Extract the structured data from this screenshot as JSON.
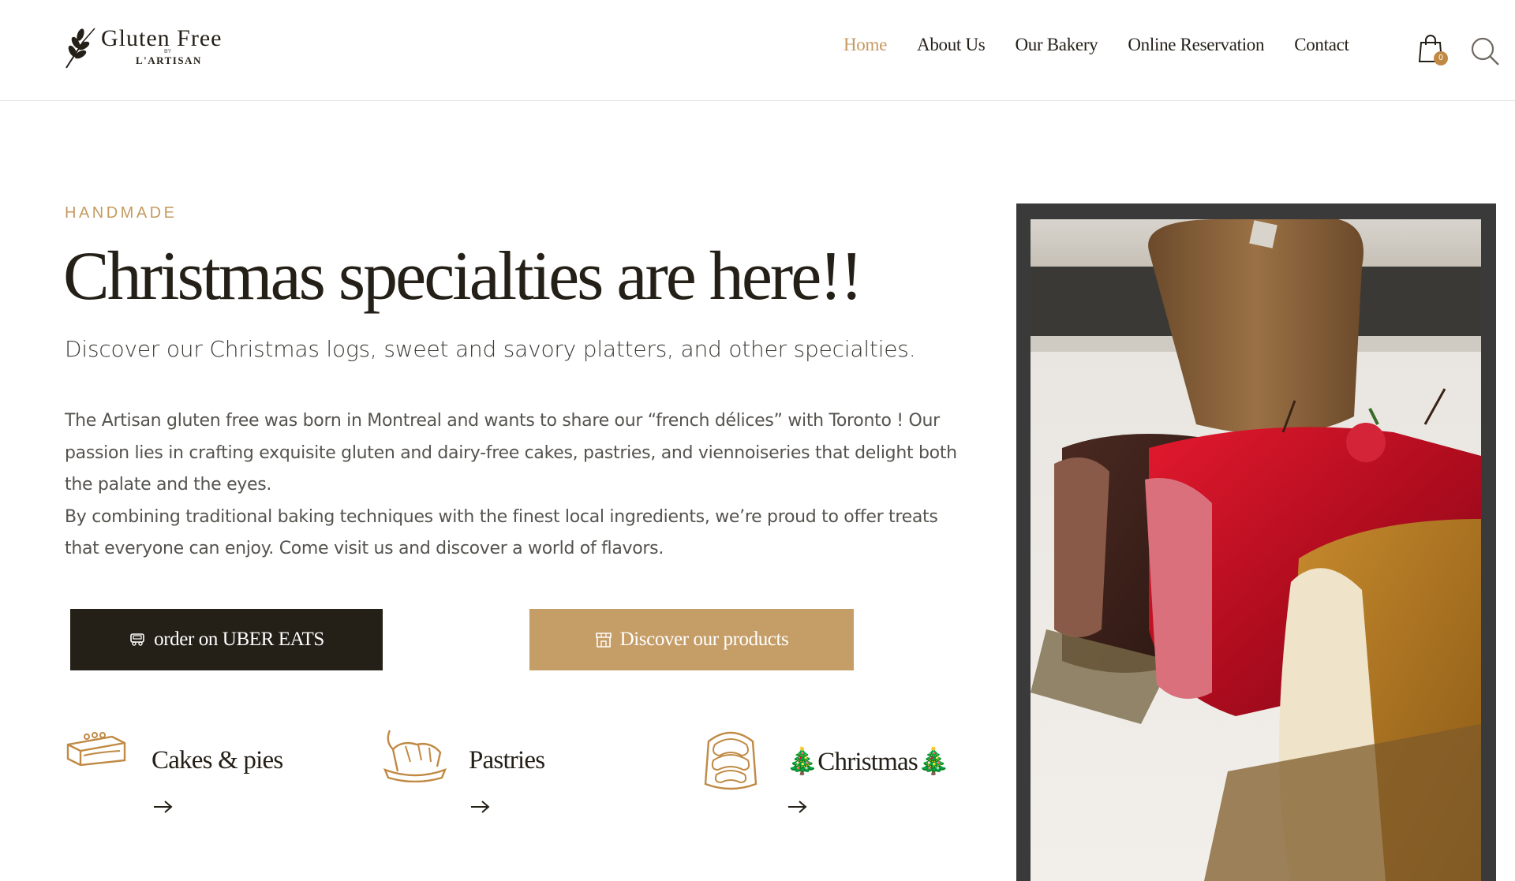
{
  "brand": {
    "title": "Gluten Free",
    "by": "BY",
    "subtitle": "L'ARTISAN"
  },
  "nav": {
    "items": [
      {
        "label": "Home",
        "active": true
      },
      {
        "label": "About Us"
      },
      {
        "label": "Our Bakery"
      },
      {
        "label": "Online Reservation"
      },
      {
        "label": "Contact"
      }
    ]
  },
  "cart": {
    "count": "0",
    "icon": "shopping-bag-icon"
  },
  "search": {
    "icon": "search-icon"
  },
  "hero": {
    "eyebrow": "HANDMADE",
    "headline": "Christmas specialties are here!!",
    "subhead": "Discover our Christmas logs, sweet and savory platters, and other specialties.",
    "paragraph1": "The Artisan gluten free was born in Montreal and wants to share our “french délices” with Toronto ! Our passion lies in crafting exquisite gluten and dairy-free cakes, pastries, and viennoiseries that delight both the palate and the eyes.",
    "paragraph2": "By combining traditional baking techniques with the finest local ingredients, we’re proud to offer treats that everyone can enjoy. Come visit us and discover a world of flavors."
  },
  "buttons": {
    "uber": {
      "label": "order on UBER EATS",
      "icon": "delivery-truck-icon"
    },
    "products": {
      "label": "Discover our products",
      "icon": "storefront-icon"
    }
  },
  "categories": [
    {
      "label": "Cakes & pies",
      "icon": "cake-icon",
      "arrow": "→"
    },
    {
      "label": "Pastries",
      "icon": "croissant-icon",
      "arrow": "→"
    },
    {
      "label": "🎄Christmas🎄",
      "icon": "yule-log-icon",
      "arrow": "→"
    }
  ],
  "colors": {
    "accent": "#c59a5f",
    "dark": "#241f17",
    "button_gold": "#c59d67"
  }
}
